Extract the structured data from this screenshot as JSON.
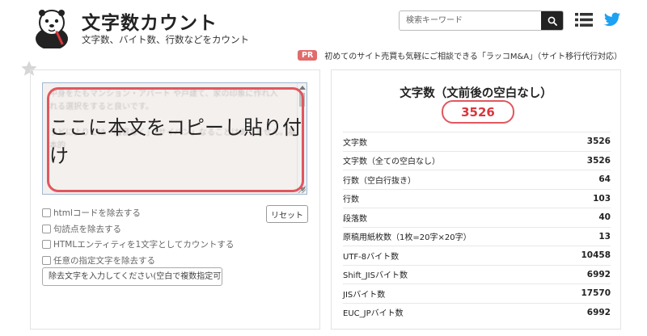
{
  "header": {
    "title": "文字数カウント",
    "subtitle": "文字数、バイト数、行数などをカウント",
    "search_placeholder": "検索キーワード"
  },
  "pr": {
    "badge": "PR",
    "text": "初めてのサイト売買も気軽にご相談できる「ラッコM&A」（サイト移行代行対応）"
  },
  "editor": {
    "overlay_text": "ここに本文をコピーし貼り付け",
    "ghost_text": "中身をたもマンション・アパート や戸建て、家の印象に作れ入\nれる選択をすると良いです。\n\nうどによりては「騒音なく」「サイバン」なることはありません。基本的\n\n\n\n\nよい。挑戦を実施すると良い"
  },
  "options": [
    {
      "label": "htmlコードを除去する",
      "checked": false
    },
    {
      "label": "句読点を除去する",
      "checked": false
    },
    {
      "label": "HTMLエンティティを1文字としてカウントする",
      "checked": false
    },
    {
      "label": "任意の指定文字を除去する",
      "checked": false
    }
  ],
  "reset_label": "リセット",
  "remove_input_placeholder": "除去文字を入力してください(空白で複数指定可)",
  "result": {
    "main_label": "文字数（文前後の空白なし）",
    "main_value": "3526",
    "stats": [
      {
        "label": "文字数",
        "value": "3526"
      },
      {
        "label": "文字数（全ての空白なし）",
        "value": "3526"
      },
      {
        "label": "行数（空白行抜き）",
        "value": "64"
      },
      {
        "label": "行数",
        "value": "103"
      },
      {
        "label": "段落数",
        "value": "40"
      },
      {
        "label": "原稿用紙枚数（1枚=20字×20字）",
        "value": "13"
      },
      {
        "label": "UTF-8バイト数",
        "value": "10458"
      },
      {
        "label": "Shift_JISバイト数",
        "value": "6992"
      },
      {
        "label": "JISバイト数",
        "value": "17570"
      },
      {
        "label": "EUC_JPバイト数",
        "value": "6992"
      }
    ]
  },
  "icons": {
    "mascot": "sea-otter-mascot-icon",
    "search": "search-icon",
    "menu": "list-menu-icon",
    "twitter": "twitter-icon",
    "favorite": "star-icon"
  },
  "colors": {
    "accent_red": "#e0575f",
    "twitter_blue": "#1da1f2",
    "pr_badge": "#e06c6c"
  }
}
